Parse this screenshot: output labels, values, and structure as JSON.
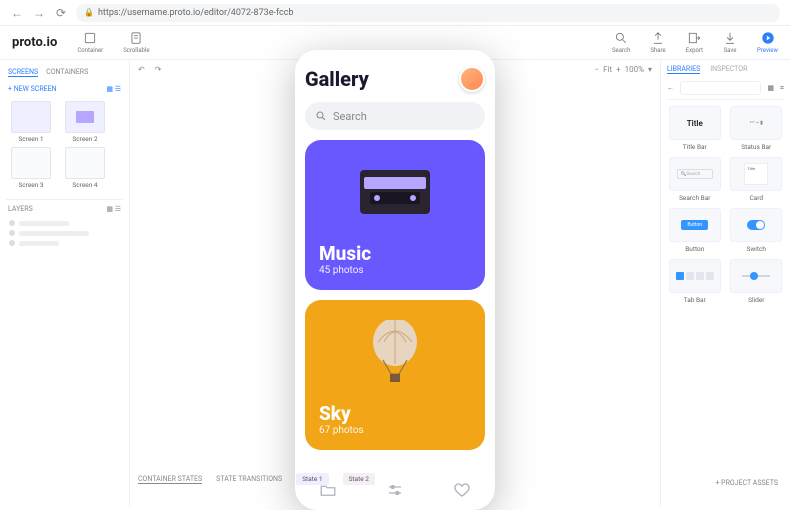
{
  "browser": {
    "url": "https://username.proto.io/editor/4072-873e-fccb"
  },
  "logo": "proto.io",
  "header": {
    "container": "Container",
    "scrollable": "Scrollable",
    "search": "Search",
    "share": "Share",
    "export": "Export",
    "save": "Save",
    "preview": "Preview"
  },
  "left": {
    "tab_screens": "SCREENS",
    "tab_containers": "CONTAINERS",
    "new_screen": "+ NEW SCREEN",
    "thumbs": [
      {
        "label": "Screen 1"
      },
      {
        "label": "Screen 2"
      },
      {
        "label": "Screen 3"
      },
      {
        "label": "Screen 4"
      }
    ],
    "layers_hdr": "LAYERS"
  },
  "canvas_toolbar": {
    "zoom_fit": "Fit",
    "zoom_pct": "100%"
  },
  "device": {
    "title": "Gallery",
    "search_placeholder": "Search",
    "cards": [
      {
        "title": "Music",
        "subtitle": "45 photos"
      },
      {
        "title": "Sky",
        "subtitle": "67 photos"
      }
    ]
  },
  "states": {
    "tab1": "CONTAINER STATES",
    "tab2": "STATE TRANSITIONS",
    "s1": "State 1",
    "s2": "State 2",
    "project_assets": "+ PROJECT ASSETS"
  },
  "right": {
    "tab_libraries": "LIBRARIES",
    "tab_inspector": "INSPECTOR",
    "items": [
      {
        "label": "Title Bar"
      },
      {
        "label": "Status Bar"
      },
      {
        "label": "Search Bar"
      },
      {
        "label": "Card"
      },
      {
        "label": "Button"
      },
      {
        "label": "Switch"
      },
      {
        "label": "Tab Bar"
      },
      {
        "label": "Slider"
      }
    ],
    "preview_title": "Title",
    "preview_search": "Search",
    "preview_button": "Button",
    "preview_card_title": "Title"
  }
}
